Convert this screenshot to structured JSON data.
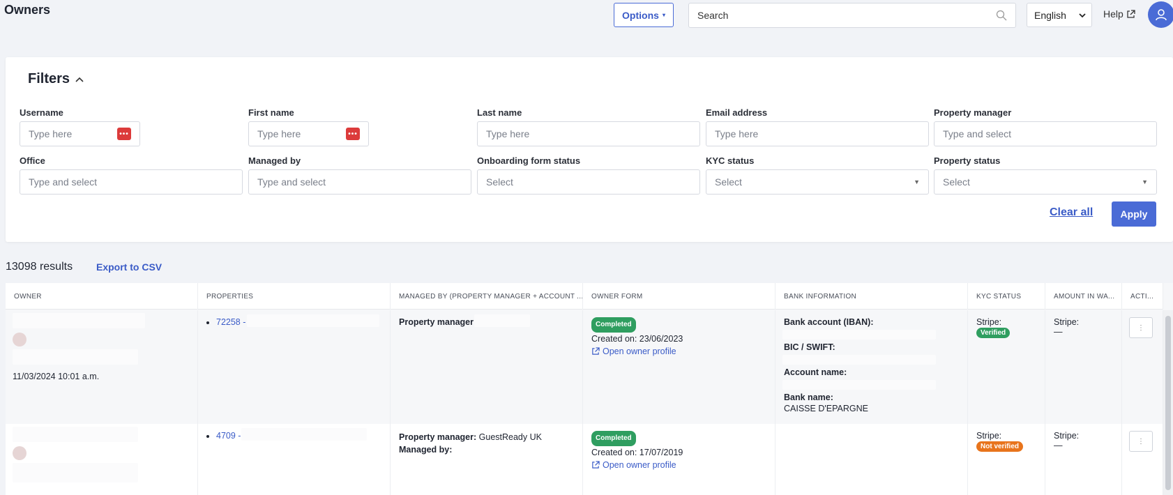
{
  "header": {
    "title": "Owners",
    "options_label": "Options",
    "search_placeholder": "Search",
    "language": "English",
    "help_label": "Help"
  },
  "filters": {
    "title": "Filters",
    "fields": {
      "username": {
        "label": "Username",
        "placeholder": "Type here"
      },
      "first_name": {
        "label": "First name",
        "placeholder": "Type here"
      },
      "last_name": {
        "label": "Last name",
        "placeholder": "Type here"
      },
      "email": {
        "label": "Email address",
        "placeholder": "Type here"
      },
      "property_manager": {
        "label": "Property manager",
        "placeholder": "Type and select"
      },
      "office": {
        "label": "Office",
        "placeholder": "Type and select"
      },
      "managed_by": {
        "label": "Managed by",
        "placeholder": "Type and select"
      },
      "onboarding_status": {
        "label": "Onboarding form status",
        "placeholder": "Select"
      },
      "kyc_status": {
        "label": "KYC status",
        "placeholder": "Select"
      },
      "property_status": {
        "label": "Property status",
        "placeholder": "Select"
      }
    },
    "clear_all_label": "Clear all",
    "apply_label": "Apply"
  },
  "results": {
    "count": "13098 results",
    "export_label": "Export to CSV"
  },
  "table": {
    "columns": [
      "Owner",
      "Properties",
      "Managed by (property manager + account ...",
      "Owner form",
      "Bank information",
      "KYC status",
      "Amount in wa...",
      "Acti..."
    ],
    "rows": [
      {
        "owner_date": "11/03/2024 10:01 a.m.",
        "property_id": "72258 -",
        "pm_label": "Property manager:",
        "pm_value": "",
        "managed_by_label": "",
        "form_status": "Completed",
        "created_on": "Created on: 23/06/2023",
        "open_profile": "Open owner profile",
        "bank_iban_label": "Bank account (IBAN):",
        "bank_bic_label": "BIC / SWIFT:",
        "bank_account_name_label": "Account name:",
        "bank_name_label": "Bank name:",
        "bank_name_value": "CAISSE D'EPARGNE",
        "kyc_provider": "Stripe:",
        "kyc_status": "Verified",
        "amount_provider": "Stripe:",
        "amount_value": "—"
      },
      {
        "owner_date": "",
        "property_id": "4709 -",
        "pm_label": "Property manager:",
        "pm_value": "GuestReady UK",
        "managed_by_label": "Managed by:",
        "form_status": "Completed",
        "created_on": "Created on: 17/07/2019",
        "open_profile": "Open owner profile",
        "kyc_provider": "Stripe:",
        "kyc_status": "Not verified",
        "amount_provider": "Stripe:",
        "amount_value": "—"
      }
    ]
  },
  "colors": {
    "accent": "#4a6bd6",
    "verified": "#2f9e60",
    "not_verified": "#e8741c",
    "password_icon": "#dc3b3b"
  },
  "icons": {
    "search": "search-icon",
    "external_link": "external-link-icon",
    "user": "user-icon",
    "chevron_up": "chevron-up-icon",
    "password": "password-manager-icon",
    "more": "more-vertical-icon"
  }
}
